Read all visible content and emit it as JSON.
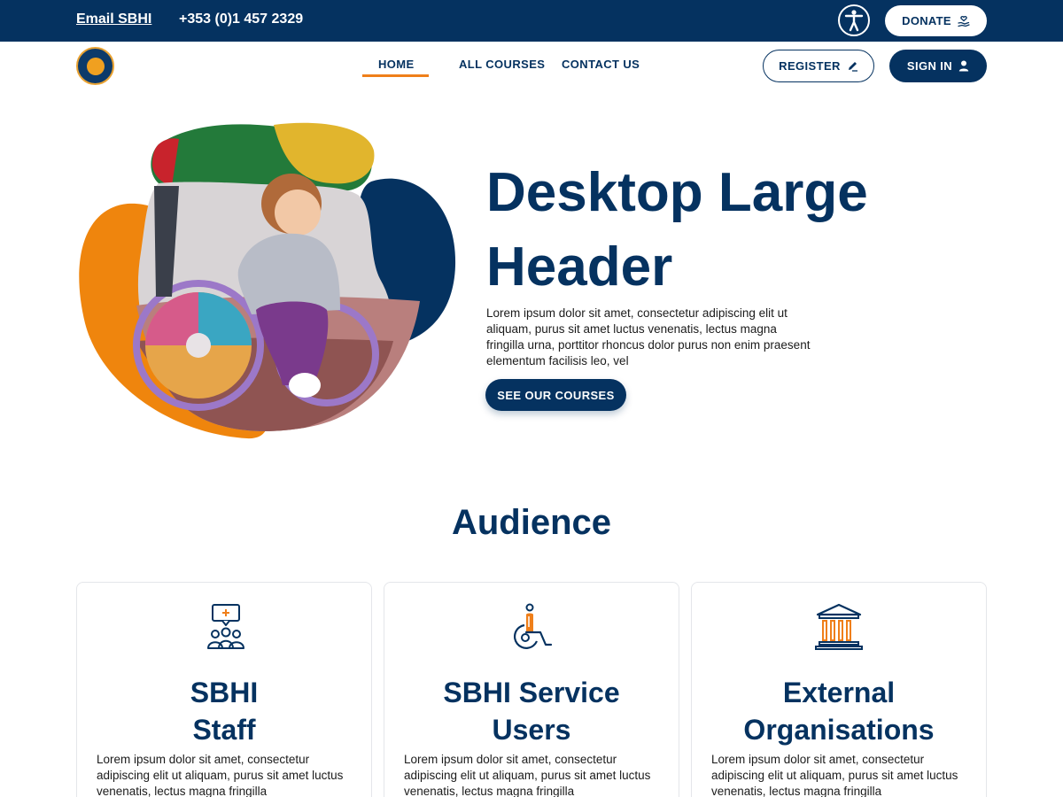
{
  "topbar": {
    "email_label": "Email SBHI",
    "phone": "+353 (0)1 457 2329",
    "accessibility_icon": "accessibility-icon",
    "donate_label": "DONATE",
    "donate_icon": "hand-heart-icon"
  },
  "nav": {
    "items": [
      {
        "label": "HOME",
        "active": true
      },
      {
        "label": "ALL COURSES"
      },
      {
        "label": "CONTACT US"
      }
    ],
    "register_label": "REGISTER",
    "register_icon": "pencil-icon",
    "signin_label": "SIGN IN",
    "signin_icon": "user-icon"
  },
  "hero": {
    "title": "Desktop Large Header",
    "text": "Lorem ipsum dolor sit amet, consectetur adipiscing elit ut aliquam, purus sit amet luctus venenatis, lectus magna fringilla urna, porttitor rhoncus dolor purus non enim praesent elementum facilisis leo, vel",
    "button_label": "SEE OUR COURSES"
  },
  "audience": {
    "title": "Audience",
    "cards": [
      {
        "title_line1": "SBHI",
        "title_line2": "Staff",
        "icon": "staff-group-icon",
        "text": "Lorem ipsum dolor sit amet, consectetur adipiscing elit ut aliquam, purus sit amet luctus venenatis, lectus magna fringilla"
      },
      {
        "title_line1": "SBHI Service",
        "title_line2": "Users",
        "icon": "wheelchair-user-icon",
        "text": "Lorem ipsum dolor sit amet, consectetur adipiscing elit ut aliquam, purus sit amet luctus venenatis, lectus magna fringilla"
      },
      {
        "title_line1": "External",
        "title_line2": "Organisations",
        "icon": "institution-building-icon",
        "text": "Lorem ipsum dolor sit amet, consectetur adipiscing elit ut aliquam, purus sit amet luctus venenatis, lectus magna fringilla"
      }
    ]
  },
  "colors": {
    "navy": "#053260",
    "orange": "#ef7f1a",
    "yellow": "#e3b52c",
    "green": "#2d7a3e",
    "red": "#c8232c"
  }
}
